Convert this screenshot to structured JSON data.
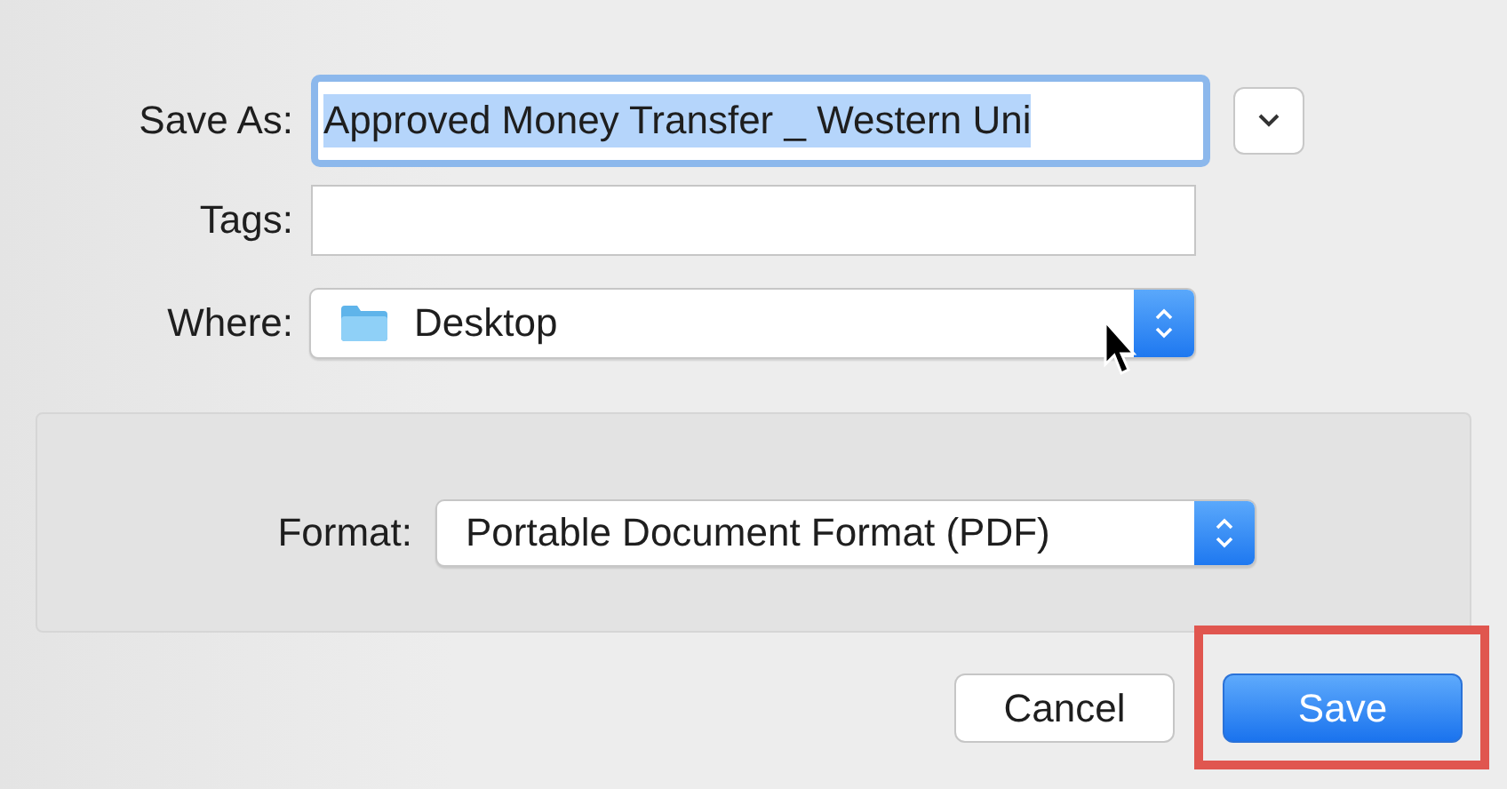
{
  "save_as": {
    "label": "Save As:",
    "value": "Approved Money Transfer _ Western Uni",
    "selected": true
  },
  "tags": {
    "label": "Tags:"
  },
  "where": {
    "label": "Where:",
    "value": "Desktop"
  },
  "format": {
    "label": "Format:",
    "value": "Portable Document Format (PDF)"
  },
  "buttons": [
    {
      "label": "Cancel",
      "kind": "secondary",
      "highlighted": false
    },
    {
      "label": "Save",
      "kind": "default",
      "highlighted": true
    }
  ]
}
